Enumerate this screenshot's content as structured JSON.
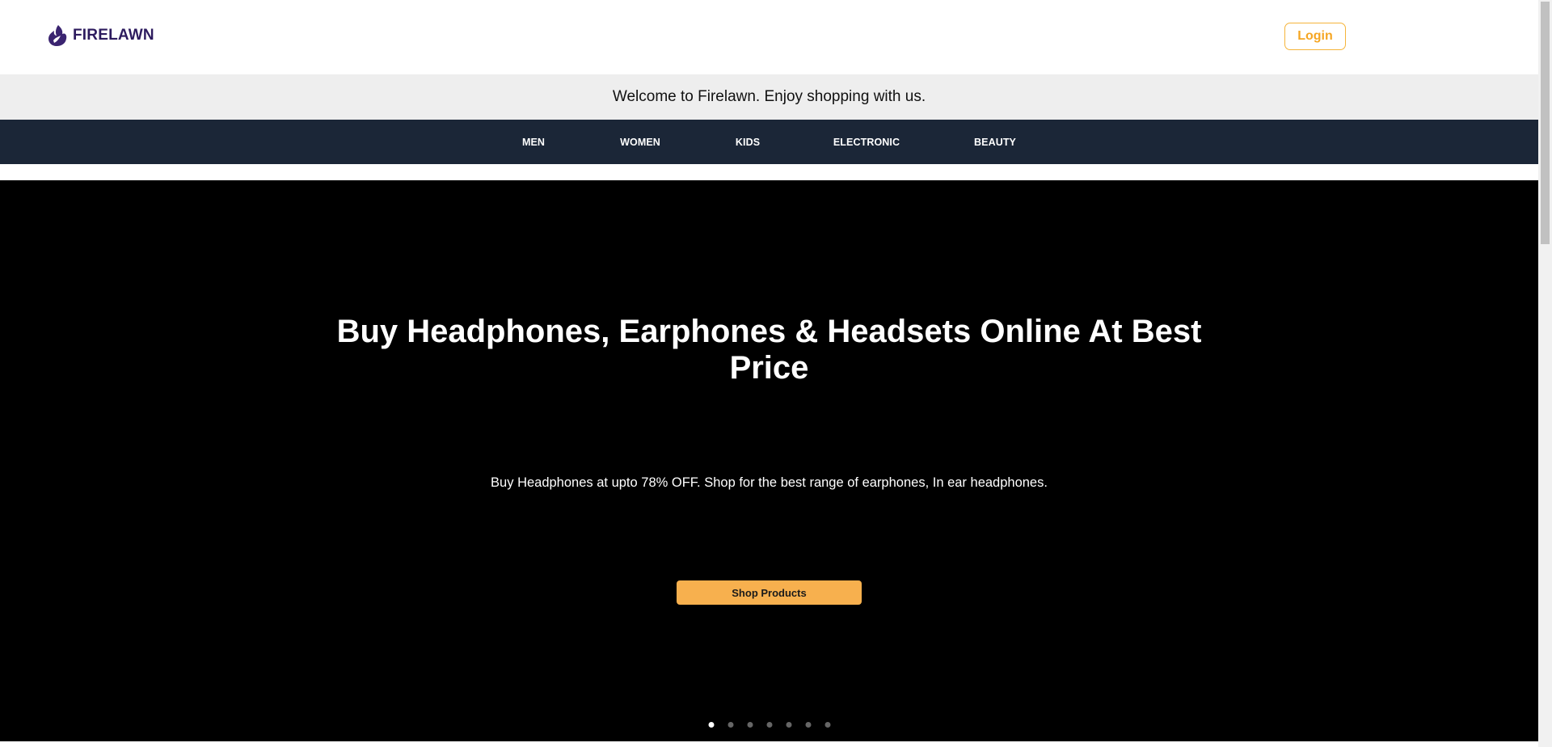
{
  "brand": {
    "name": "FIRELAWN",
    "color": "#2d1b5e"
  },
  "header": {
    "login_label": "Login",
    "accent_color": "#f5a623"
  },
  "welcome": {
    "text": "Welcome to Firelawn. Enjoy shopping with us."
  },
  "nav": {
    "items": [
      {
        "label": "MEN"
      },
      {
        "label": "WOMEN"
      },
      {
        "label": "KIDS"
      },
      {
        "label": "ELECTRONIC"
      },
      {
        "label": "BEAUTY"
      }
    ],
    "background": "#1b2637"
  },
  "hero": {
    "title_line1": "Buy Headphones, Earphones & Headsets Online At Best",
    "title_line2": "Price",
    "subtitle": "Buy Headphones at upto 78% OFF. Shop for the best range of earphones, In ear headphones.",
    "cta_label": "Shop Products",
    "cta_color": "#f7b04e",
    "slide_count": 7,
    "active_slide": 1
  }
}
